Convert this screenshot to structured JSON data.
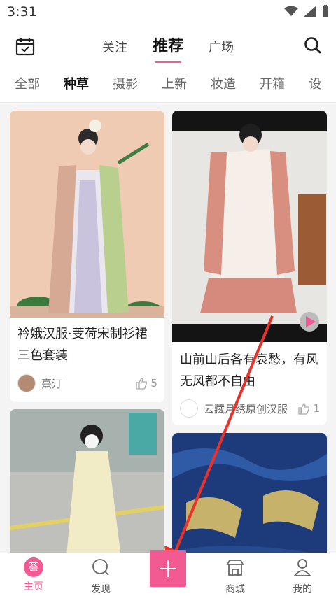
{
  "status": {
    "time": "3:31"
  },
  "header": {
    "tabs": [
      "关注",
      "推荐",
      "广场"
    ],
    "active_tab": 1
  },
  "categories": {
    "items": [
      "全部",
      "种草",
      "摄影",
      "上新",
      "妆造",
      "开箱",
      "设"
    ],
    "active": 1
  },
  "feed": {
    "cards": [
      {
        "title": "衿娥汉服·芰荷宋制衫裙三色套装",
        "author": "熹汀",
        "likes": "5"
      },
      {
        "title": "山前山后各有哀愁，有风无风都不自由",
        "author": "云藏月绣原创汉服",
        "likes": "1",
        "is_video": true
      },
      {
        "title": "",
        "author": "",
        "likes": ""
      },
      {
        "title": "",
        "author": "",
        "likes": ""
      }
    ]
  },
  "nav": {
    "home": "主页",
    "home_badge": "荟",
    "discover": "发现",
    "mall": "商城",
    "mine": "我的"
  },
  "colors": {
    "accent": "#f35a93",
    "annotation_arrow": "#e8322a"
  }
}
